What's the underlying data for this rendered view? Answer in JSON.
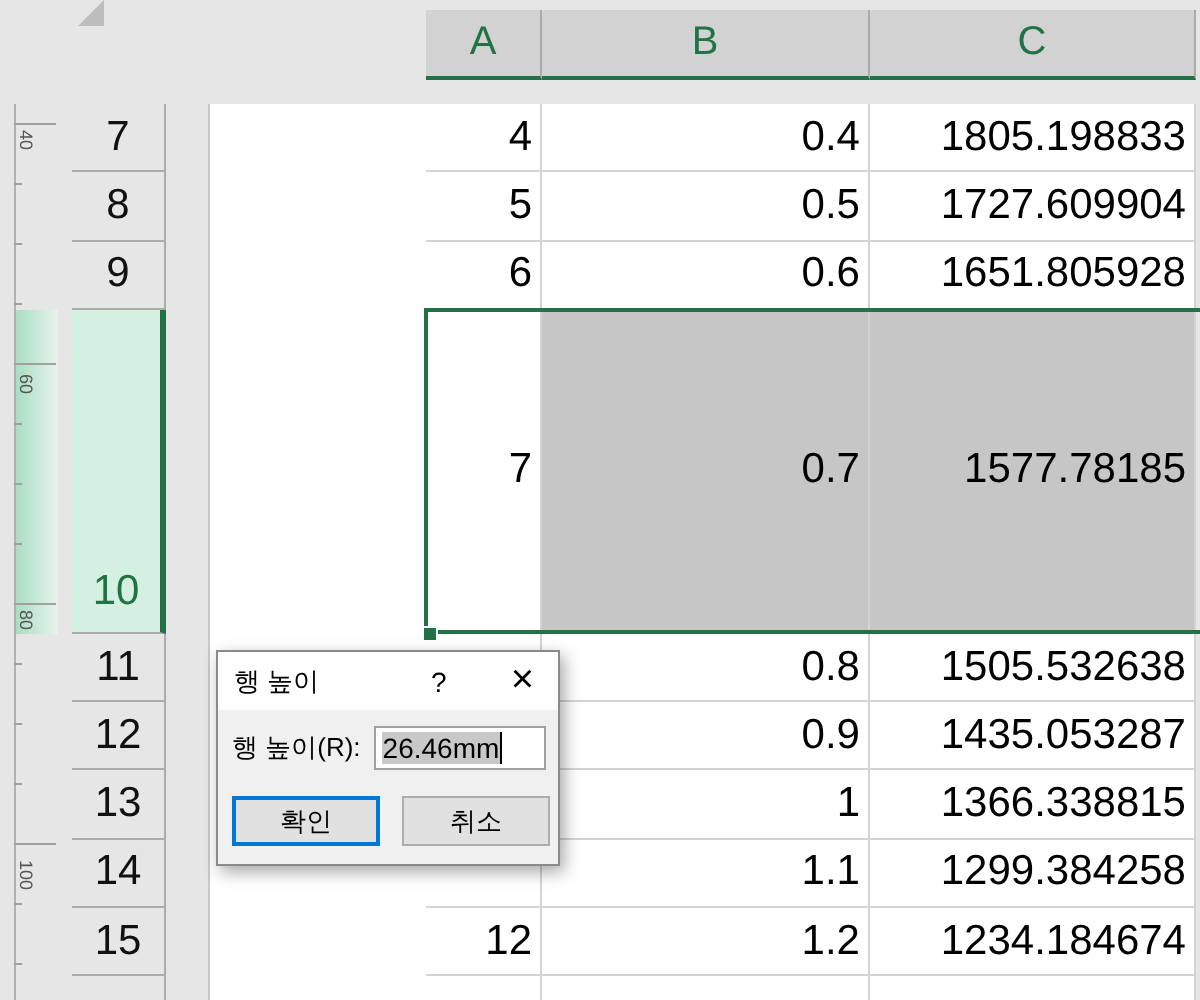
{
  "columns": [
    {
      "label": "A",
      "selected": true
    },
    {
      "label": "B",
      "selected": true
    },
    {
      "label": "C",
      "selected": true
    }
  ],
  "ruler": {
    "labels": [
      "40",
      "60",
      "80",
      "100"
    ]
  },
  "rows": [
    {
      "header": "7",
      "selected": false,
      "kind": "normal",
      "cells": [
        "4",
        "0.4",
        "1805.198833"
      ]
    },
    {
      "header": "8",
      "selected": false,
      "kind": "normal",
      "cells": [
        "5",
        "0.5",
        "1727.609904"
      ]
    },
    {
      "header": "9",
      "selected": false,
      "kind": "normal",
      "cells": [
        "6",
        "0.6",
        "1651.805928"
      ]
    },
    {
      "header": "10",
      "selected": true,
      "kind": "tall",
      "cells": [
        "7",
        "0.7",
        "1577.78185"
      ]
    },
    {
      "header": "11",
      "selected": false,
      "kind": "normal",
      "cells": [
        null,
        "0.8",
        "1505.532638"
      ]
    },
    {
      "header": "12",
      "selected": false,
      "kind": "normal",
      "cells": [
        null,
        "0.9",
        "1435.053287"
      ]
    },
    {
      "header": "13",
      "selected": false,
      "kind": "normal",
      "cells": [
        null,
        "1",
        "1366.338815"
      ]
    },
    {
      "header": "14",
      "selected": false,
      "kind": "normal",
      "cells": [
        null,
        "1.1",
        "1299.384258"
      ]
    },
    {
      "header": "15",
      "selected": false,
      "kind": "normal",
      "cells": [
        "12",
        "1.2",
        "1234.184674"
      ]
    }
  ],
  "dialog": {
    "title": "행 높이",
    "help": "?",
    "close": "×",
    "label": "행 높이(R):",
    "value": "26.46mm",
    "buttons": [
      {
        "label": "확인",
        "default": true
      },
      {
        "label": "취소",
        "default": false
      }
    ]
  }
}
